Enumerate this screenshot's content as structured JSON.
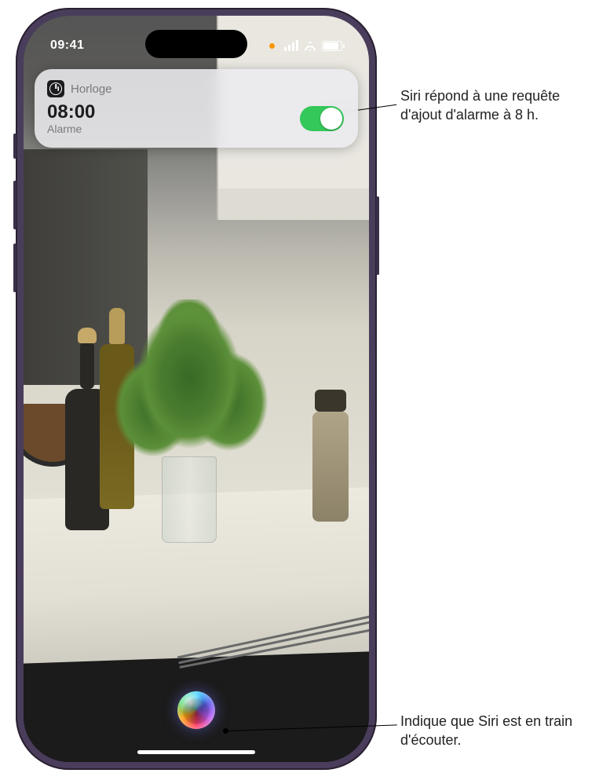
{
  "status_bar": {
    "time": "09:41"
  },
  "notification": {
    "app_name": "Horloge",
    "alarm_time": "08:00",
    "subtitle": "Alarme",
    "toggle_on": true
  },
  "siri": {
    "icon": "siri-orb"
  },
  "callouts": {
    "alarm_response": "Siri répond à une requête d'ajout d'alarme à 8 h.",
    "listening": "Indique que Siri est en train d'écouter."
  }
}
